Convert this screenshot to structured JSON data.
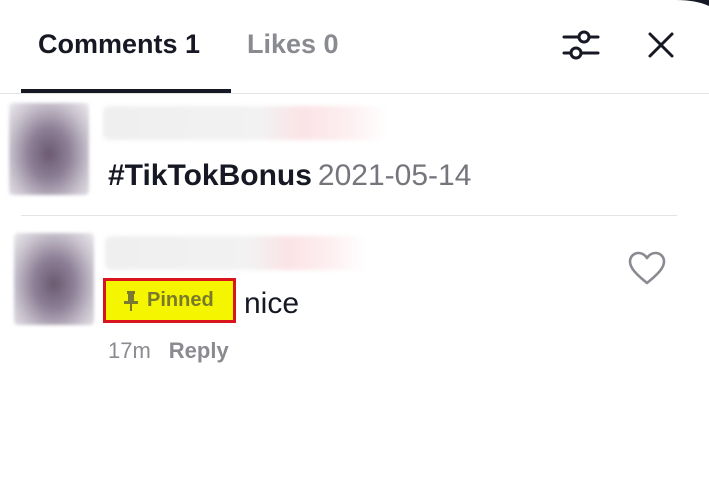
{
  "tabs": {
    "comments_label": "Comments 1",
    "likes_label": "Likes 0",
    "active": "comments"
  },
  "icons": {
    "filter": "sliders-icon",
    "close": "close-icon",
    "like": "heart-icon",
    "pin": "pin-icon"
  },
  "post": {
    "hashtag": "#TikTokBonus",
    "date": "2021-05-14"
  },
  "comment": {
    "pinned_label": "Pinned",
    "text": "nice",
    "time": "17m",
    "reply_label": "Reply"
  },
  "colors": {
    "highlight": "#f5f500",
    "highlight_border": "#d8141c",
    "text_primary": "#161823",
    "text_secondary": "#8a8b91"
  }
}
